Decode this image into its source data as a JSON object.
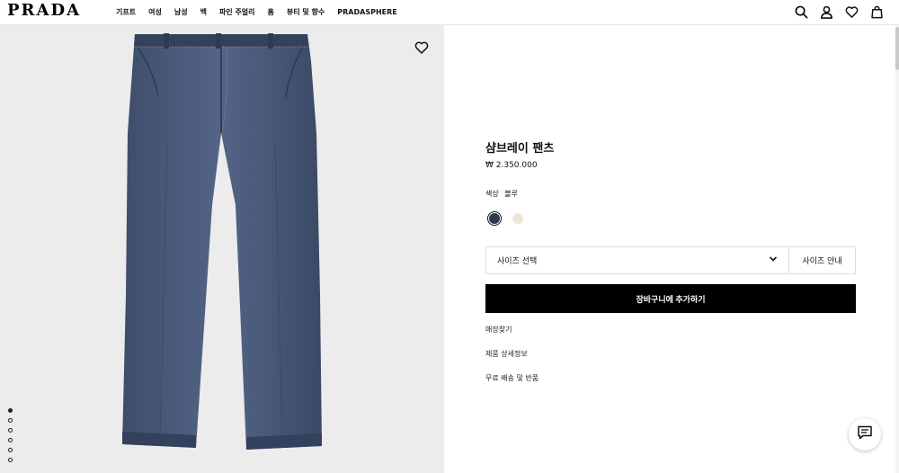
{
  "header": {
    "logo": "PRADA",
    "nav": [
      "기프트",
      "여성",
      "남성",
      "백",
      "파인 주얼리",
      "홈",
      "뷰티 및 향수",
      "PRADASPHERE"
    ],
    "icons": [
      "search-icon",
      "account-icon",
      "wishlist-icon",
      "bag-icon"
    ]
  },
  "gallery": {
    "image": "denim-pants-photo",
    "dots": 6,
    "active_dot": 0
  },
  "product": {
    "title": "샴브레이 팬츠",
    "price": "₩ 2.350.000",
    "color_label": "색상",
    "color_value": "블루",
    "swatches": [
      {
        "name": "blue",
        "color": "#2c3a4f",
        "selected": true
      },
      {
        "name": "cream",
        "color": "#ece6d6",
        "selected": false
      }
    ],
    "size_select": "사이즈 선택",
    "size_guide": "사이즈 안내",
    "add_to_cart": "장바구니에 추가하기",
    "links": [
      "매장찾기",
      "제품 상세정보",
      "무료 배송 및 반품"
    ]
  },
  "colors": {
    "gallery_bg": "#ececec",
    "denim": "#4a5a78",
    "button": "#000000"
  }
}
